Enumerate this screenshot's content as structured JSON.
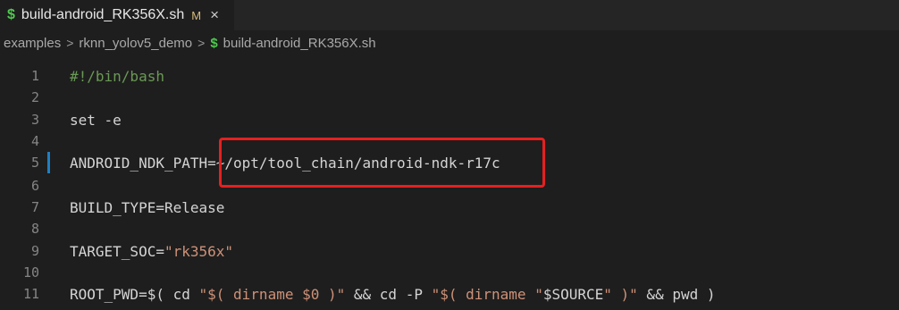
{
  "tab": {
    "icon": "$",
    "filename": "build-android_RK356X.sh",
    "modified": "M",
    "close": "×"
  },
  "breadcrumb": {
    "items": [
      "examples",
      "rknn_yolov5_demo"
    ],
    "file_icon": "$",
    "file": "build-android_RK356X.sh"
  },
  "lines": [
    {
      "n": "1",
      "text": "#!/bin/bash"
    },
    {
      "n": "2",
      "text": ""
    },
    {
      "n": "3",
      "text": "set -e"
    },
    {
      "n": "4",
      "text": ""
    },
    {
      "n": "5",
      "text": "ANDROID_NDK_PATH=~/opt/tool_chain/android-ndk-r17c"
    },
    {
      "n": "6",
      "text": ""
    },
    {
      "n": "7",
      "text": "BUILD_TYPE=Release"
    },
    {
      "n": "8",
      "text": ""
    },
    {
      "n": "9",
      "text": "TARGET_SOC=\"rk356x\""
    },
    {
      "n": "10",
      "text": ""
    },
    {
      "n": "11",
      "text": "ROOT_PWD=$( cd \"$( dirname $0 )\" && cd -P \"$( dirname \"$SOURCE\" )\" && pwd )"
    }
  ],
  "colors": {
    "accent_green": "#4ec94e",
    "highlight_red": "#e62020",
    "string_orange": "#ce9178",
    "gutter_blue": "#1f7fc2"
  }
}
